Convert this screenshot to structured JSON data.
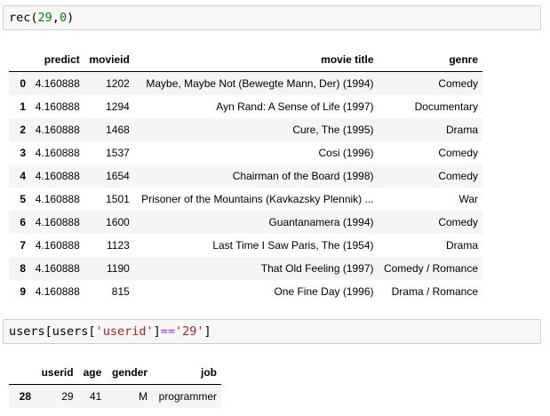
{
  "cell1": {
    "fn": "rec",
    "open": "(",
    "a1": "29",
    "comma": ",",
    "a2": "0",
    "close": ")"
  },
  "table1": {
    "columns": [
      "predict",
      "movieid",
      "movie title",
      "genre"
    ],
    "rows": [
      {
        "idx": "0",
        "predict": "4.160888",
        "movieid": "1202",
        "title": "Maybe, Maybe Not (Bewegte Mann, Der) (1994)",
        "genre": "Comedy"
      },
      {
        "idx": "1",
        "predict": "4.160888",
        "movieid": "1294",
        "title": "Ayn Rand: A Sense of Life (1997)",
        "genre": "Documentary"
      },
      {
        "idx": "2",
        "predict": "4.160888",
        "movieid": "1468",
        "title": "Cure, The (1995)",
        "genre": "Drama"
      },
      {
        "idx": "3",
        "predict": "4.160888",
        "movieid": "1537",
        "title": "Cosi (1996)",
        "genre": "Comedy"
      },
      {
        "idx": "4",
        "predict": "4.160888",
        "movieid": "1654",
        "title": "Chairman of the Board (1998)",
        "genre": "Comedy"
      },
      {
        "idx": "5",
        "predict": "4.160888",
        "movieid": "1501",
        "title": "Prisoner of the Mountains (Kavkazsky Plennik) ...",
        "genre": "War"
      },
      {
        "idx": "6",
        "predict": "4.160888",
        "movieid": "1600",
        "title": "Guantanamera (1994)",
        "genre": "Comedy"
      },
      {
        "idx": "7",
        "predict": "4.160888",
        "movieid": "1123",
        "title": "Last Time I Saw Paris, The (1954)",
        "genre": "Drama"
      },
      {
        "idx": "8",
        "predict": "4.160888",
        "movieid": "1190",
        "title": "That Old Feeling (1997)",
        "genre": "Comedy / Romance"
      },
      {
        "idx": "9",
        "predict": "4.160888",
        "movieid": "815",
        "title": "One Fine Day (1996)",
        "genre": "Drama / Romance"
      }
    ]
  },
  "cell2": {
    "var": "users",
    "lb": "[",
    "key": "'userid'",
    "rb": "]",
    "op": "==",
    "val": "'29'"
  },
  "table2": {
    "columns": [
      "userid",
      "age",
      "gender",
      "job"
    ],
    "rows": [
      {
        "idx": "28",
        "userid": "29",
        "age": "41",
        "gender": "M",
        "job": "programmer"
      }
    ]
  }
}
